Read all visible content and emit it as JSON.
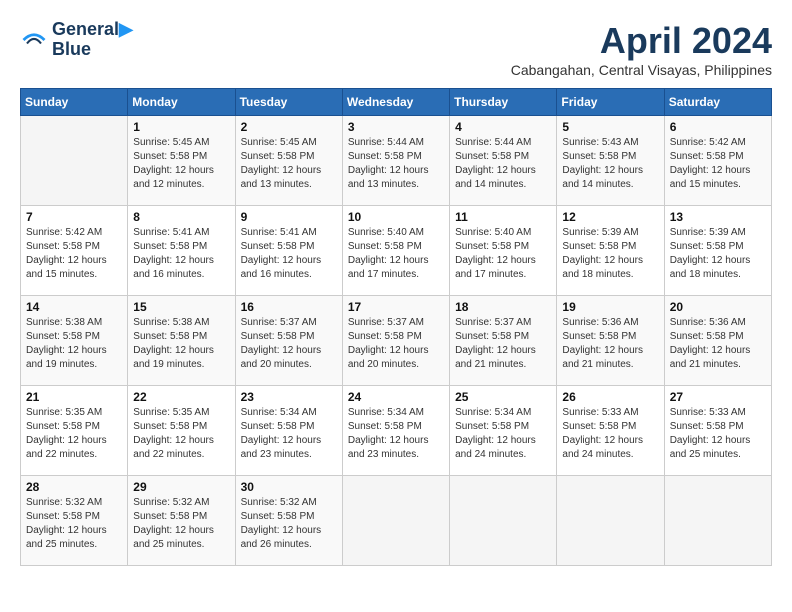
{
  "logo": {
    "line1": "General",
    "line2": "Blue"
  },
  "title": "April 2024",
  "subtitle": "Cabangahan, Central Visayas, Philippines",
  "headers": [
    "Sunday",
    "Monday",
    "Tuesday",
    "Wednesday",
    "Thursday",
    "Friday",
    "Saturday"
  ],
  "weeks": [
    [
      {
        "day": "",
        "info": ""
      },
      {
        "day": "1",
        "info": "Sunrise: 5:45 AM\nSunset: 5:58 PM\nDaylight: 12 hours\nand 12 minutes."
      },
      {
        "day": "2",
        "info": "Sunrise: 5:45 AM\nSunset: 5:58 PM\nDaylight: 12 hours\nand 13 minutes."
      },
      {
        "day": "3",
        "info": "Sunrise: 5:44 AM\nSunset: 5:58 PM\nDaylight: 12 hours\nand 13 minutes."
      },
      {
        "day": "4",
        "info": "Sunrise: 5:44 AM\nSunset: 5:58 PM\nDaylight: 12 hours\nand 14 minutes."
      },
      {
        "day": "5",
        "info": "Sunrise: 5:43 AM\nSunset: 5:58 PM\nDaylight: 12 hours\nand 14 minutes."
      },
      {
        "day": "6",
        "info": "Sunrise: 5:42 AM\nSunset: 5:58 PM\nDaylight: 12 hours\nand 15 minutes."
      }
    ],
    [
      {
        "day": "7",
        "info": "Sunrise: 5:42 AM\nSunset: 5:58 PM\nDaylight: 12 hours\nand 15 minutes."
      },
      {
        "day": "8",
        "info": "Sunrise: 5:41 AM\nSunset: 5:58 PM\nDaylight: 12 hours\nand 16 minutes."
      },
      {
        "day": "9",
        "info": "Sunrise: 5:41 AM\nSunset: 5:58 PM\nDaylight: 12 hours\nand 16 minutes."
      },
      {
        "day": "10",
        "info": "Sunrise: 5:40 AM\nSunset: 5:58 PM\nDaylight: 12 hours\nand 17 minutes."
      },
      {
        "day": "11",
        "info": "Sunrise: 5:40 AM\nSunset: 5:58 PM\nDaylight: 12 hours\nand 17 minutes."
      },
      {
        "day": "12",
        "info": "Sunrise: 5:39 AM\nSunset: 5:58 PM\nDaylight: 12 hours\nand 18 minutes."
      },
      {
        "day": "13",
        "info": "Sunrise: 5:39 AM\nSunset: 5:58 PM\nDaylight: 12 hours\nand 18 minutes."
      }
    ],
    [
      {
        "day": "14",
        "info": "Sunrise: 5:38 AM\nSunset: 5:58 PM\nDaylight: 12 hours\nand 19 minutes."
      },
      {
        "day": "15",
        "info": "Sunrise: 5:38 AM\nSunset: 5:58 PM\nDaylight: 12 hours\nand 19 minutes."
      },
      {
        "day": "16",
        "info": "Sunrise: 5:37 AM\nSunset: 5:58 PM\nDaylight: 12 hours\nand 20 minutes."
      },
      {
        "day": "17",
        "info": "Sunrise: 5:37 AM\nSunset: 5:58 PM\nDaylight: 12 hours\nand 20 minutes."
      },
      {
        "day": "18",
        "info": "Sunrise: 5:37 AM\nSunset: 5:58 PM\nDaylight: 12 hours\nand 21 minutes."
      },
      {
        "day": "19",
        "info": "Sunrise: 5:36 AM\nSunset: 5:58 PM\nDaylight: 12 hours\nand 21 minutes."
      },
      {
        "day": "20",
        "info": "Sunrise: 5:36 AM\nSunset: 5:58 PM\nDaylight: 12 hours\nand 21 minutes."
      }
    ],
    [
      {
        "day": "21",
        "info": "Sunrise: 5:35 AM\nSunset: 5:58 PM\nDaylight: 12 hours\nand 22 minutes."
      },
      {
        "day": "22",
        "info": "Sunrise: 5:35 AM\nSunset: 5:58 PM\nDaylight: 12 hours\nand 22 minutes."
      },
      {
        "day": "23",
        "info": "Sunrise: 5:34 AM\nSunset: 5:58 PM\nDaylight: 12 hours\nand 23 minutes."
      },
      {
        "day": "24",
        "info": "Sunrise: 5:34 AM\nSunset: 5:58 PM\nDaylight: 12 hours\nand 23 minutes."
      },
      {
        "day": "25",
        "info": "Sunrise: 5:34 AM\nSunset: 5:58 PM\nDaylight: 12 hours\nand 24 minutes."
      },
      {
        "day": "26",
        "info": "Sunrise: 5:33 AM\nSunset: 5:58 PM\nDaylight: 12 hours\nand 24 minutes."
      },
      {
        "day": "27",
        "info": "Sunrise: 5:33 AM\nSunset: 5:58 PM\nDaylight: 12 hours\nand 25 minutes."
      }
    ],
    [
      {
        "day": "28",
        "info": "Sunrise: 5:32 AM\nSunset: 5:58 PM\nDaylight: 12 hours\nand 25 minutes."
      },
      {
        "day": "29",
        "info": "Sunrise: 5:32 AM\nSunset: 5:58 PM\nDaylight: 12 hours\nand 25 minutes."
      },
      {
        "day": "30",
        "info": "Sunrise: 5:32 AM\nSunset: 5:58 PM\nDaylight: 12 hours\nand 26 minutes."
      },
      {
        "day": "",
        "info": ""
      },
      {
        "day": "",
        "info": ""
      },
      {
        "day": "",
        "info": ""
      },
      {
        "day": "",
        "info": ""
      }
    ]
  ]
}
